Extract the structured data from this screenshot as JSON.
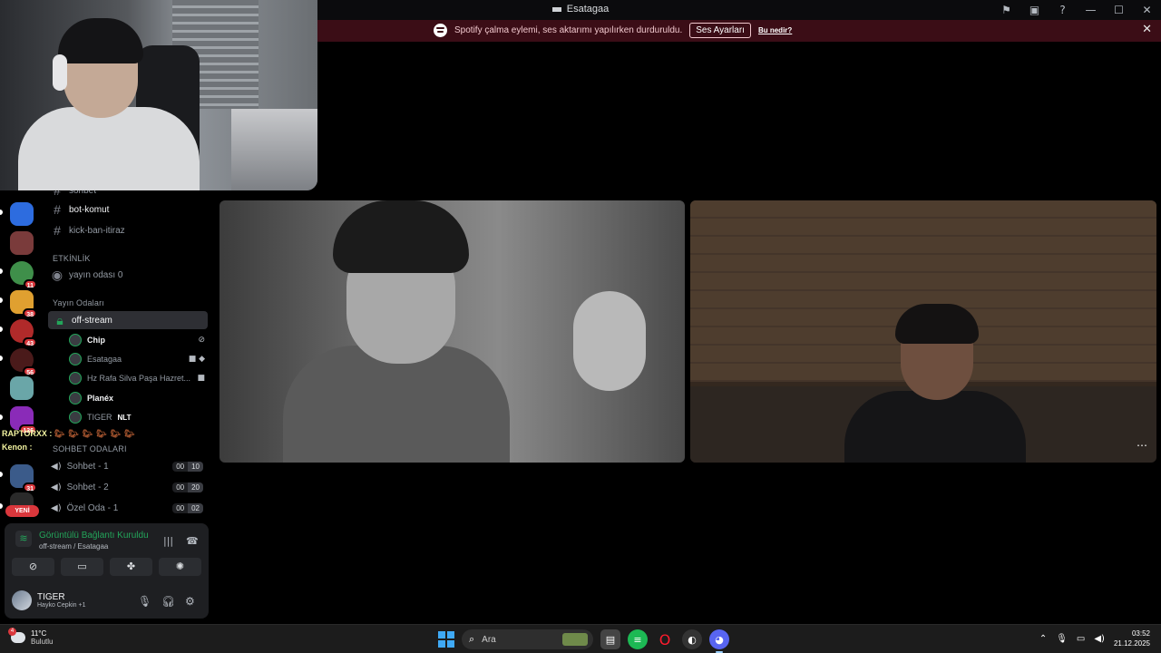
{
  "window": {
    "title": "Esatagaa",
    "icons": [
      "flag-icon",
      "inbox-icon",
      "help-icon"
    ],
    "controls": {
      "minimize": "—",
      "maximize": "☐",
      "close": "✕"
    }
  },
  "notice": {
    "message": "Spotify çalma eylemi, ses aktarımı yapılırken durduruldu.",
    "button": "Ses Ayarları",
    "link": "Bu nedir?",
    "close": "✕"
  },
  "servers": [
    {
      "name": "server-1",
      "color": "#2d6cdf",
      "badge": ""
    },
    {
      "name": "server-2",
      "color": "#7a3b3b",
      "badge": ""
    },
    {
      "name": "server-3",
      "color": "#3f8f4a",
      "badge": "11"
    },
    {
      "name": "server-4",
      "color": "#e0a030",
      "badge": "38"
    },
    {
      "name": "server-5",
      "color": "#b02a2a",
      "badge": "43"
    },
    {
      "name": "server-6",
      "color": "#4a1a1a",
      "badge": "56"
    },
    {
      "name": "server-7",
      "color": "#6aa6a8",
      "badge": ""
    },
    {
      "name": "server-8",
      "color": "#8a2bb8",
      "badge": "136"
    },
    {
      "name": "server-9",
      "color": "#3b5b8a",
      "badge": "31"
    },
    {
      "name": "server-10",
      "color": "#2a2a2a",
      "badge": ""
    }
  ],
  "new_label": "YENİ",
  "channels": {
    "text": [
      {
        "name": "sohbet"
      },
      {
        "name": "bot-komut"
      },
      {
        "name": "kick-ban-itiraz"
      }
    ],
    "category_events": "ETKİNLİK",
    "event_channel": "yayın odası 0",
    "category_stream": "Yayın Odaları",
    "active_channel": "off-stream",
    "users": [
      {
        "name": "Chip",
        "tag": ""
      },
      {
        "name": "Esatagaa",
        "tag": ""
      },
      {
        "name": "Hz Rafa Silva Paşa Hazret...",
        "tag": ""
      },
      {
        "name": "Planéx",
        "tag": ""
      },
      {
        "name": "TIGER",
        "tag": "NLT"
      }
    ],
    "category_chat": "SOHBET ODALARI",
    "voice": [
      {
        "name": "Sohbet - 1",
        "a": "00",
        "b": "10"
      },
      {
        "name": "Sohbet - 2",
        "a": "00",
        "b": "20"
      },
      {
        "name": "Özel Oda - 1",
        "a": "00",
        "b": "02"
      }
    ]
  },
  "chat_overlay": {
    "line1": "RAPTORXX :",
    "line2": "Kenon :"
  },
  "voice_panel": {
    "status": "Görüntülü Bağlantı Kuruldu",
    "location": "off-stream / Esatagaa",
    "user": "TIGER",
    "activity": "Hayko Cepkin +1"
  },
  "taskbar": {
    "temp": "11°C",
    "weather": "Bulutlu",
    "weather_badge": "4",
    "search_placeholder": "Ara",
    "time": "03:52",
    "date": "21.12.2025"
  }
}
